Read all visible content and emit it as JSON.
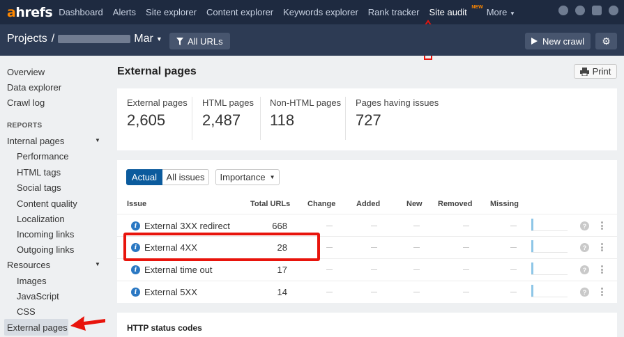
{
  "logo": {
    "a": "a",
    "rest": "hrefs"
  },
  "topnav": {
    "items": [
      "Dashboard",
      "Alerts",
      "Site explorer",
      "Content explorer",
      "Keywords explorer",
      "Rank tracker",
      "Site audit"
    ],
    "new_badge": "NEW",
    "more": "More"
  },
  "subheader": {
    "projects_label": "Projects",
    "separator": "/",
    "project_suffix": "Mar",
    "all_urls": "All URLs",
    "new_crawl": "New crawl"
  },
  "sidebar": {
    "overview": "Overview",
    "data_explorer": "Data explorer",
    "crawl_log": "Crawl log",
    "reports_heading": "REPORTS",
    "internal_pages": "Internal pages",
    "internal_children": [
      "Performance",
      "HTML tags",
      "Social tags",
      "Content quality",
      "Localization",
      "Incoming links",
      "Outgoing links"
    ],
    "resources": "Resources",
    "resources_children": [
      "Images",
      "JavaScript",
      "CSS"
    ],
    "external_pages": "External pages"
  },
  "main": {
    "title": "External pages",
    "print": "Print",
    "stats": [
      {
        "label": "External pages",
        "value": "2,605"
      },
      {
        "label": "HTML pages",
        "value": "2,487"
      },
      {
        "label": "Non-HTML pages",
        "value": "118"
      },
      {
        "label": "Pages having issues",
        "value": "727"
      }
    ],
    "tabs": {
      "actual": "Actual",
      "all_issues": "All issues",
      "importance": "Importance"
    },
    "columns": {
      "issue": "Issue",
      "total": "Total URLs",
      "change": "Change",
      "added": "Added",
      "new": "New",
      "removed": "Removed",
      "missing": "Missing"
    },
    "rows": [
      {
        "issue": "External 3XX redirect",
        "total": "668"
      },
      {
        "issue": "External 4XX",
        "total": "28"
      },
      {
        "issue": "External time out",
        "total": "17"
      },
      {
        "issue": "External 5XX",
        "total": "14"
      }
    ],
    "http_title": "HTTP status codes"
  },
  "colors": {
    "nav_bg": "#1e2a40",
    "subheader_bg": "#2d3b54",
    "accent": "#0b5b9d",
    "brand_orange": "#ff8800",
    "annotation_red": "#e8140c"
  }
}
